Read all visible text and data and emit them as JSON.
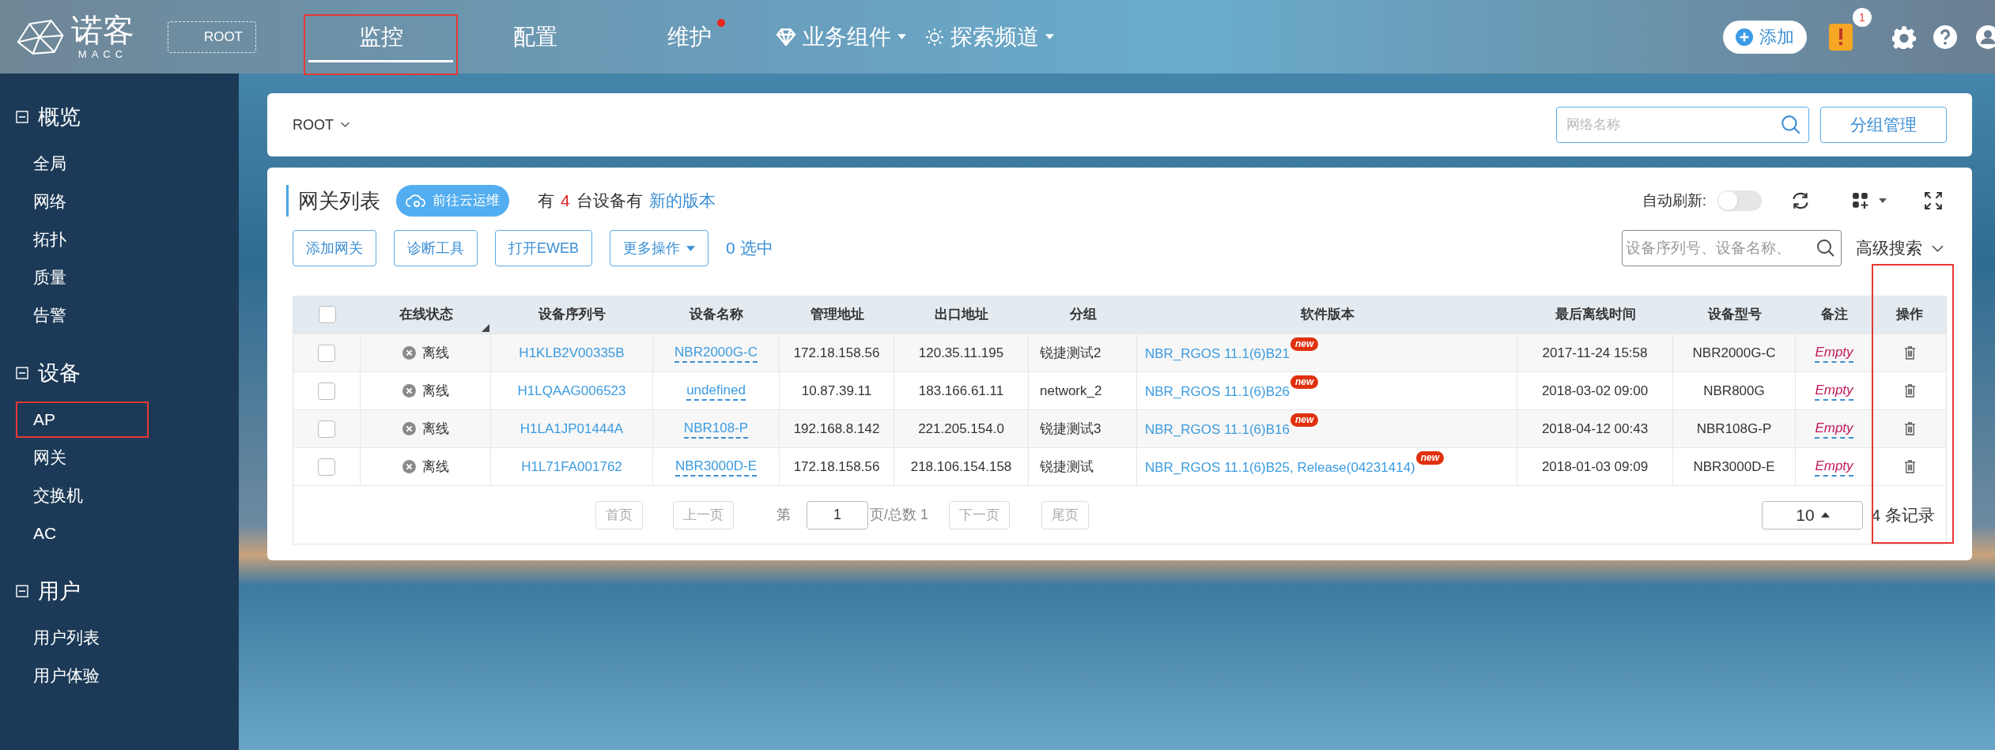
{
  "header": {
    "logo_text": "诺客",
    "logo_subtext": "MACC",
    "root_button": "ROOT",
    "tabs": [
      {
        "label": "监控",
        "selected": true,
        "highlighted": true,
        "dot": false,
        "kind": "plain"
      },
      {
        "label": "配置",
        "selected": false,
        "highlighted": false,
        "dot": false,
        "kind": "plain"
      },
      {
        "label": "维护",
        "selected": false,
        "highlighted": false,
        "dot": true,
        "kind": "plain"
      },
      {
        "label": "业务组件",
        "selected": false,
        "highlighted": false,
        "dot": false,
        "kind": "diamond-menu"
      },
      {
        "label": "探索频道",
        "selected": false,
        "highlighted": false,
        "dot": false,
        "kind": "bulb-menu"
      }
    ],
    "add_button": "添加",
    "alert_count": "1"
  },
  "sidebar": {
    "sections": [
      {
        "title": "概览",
        "expanded": true,
        "items": [
          {
            "label": "全局",
            "highlighted": false
          },
          {
            "label": "网络",
            "highlighted": false
          },
          {
            "label": "拓扑",
            "highlighted": false
          },
          {
            "label": "质量",
            "highlighted": false
          },
          {
            "label": "告警",
            "highlighted": false
          }
        ]
      },
      {
        "title": "设备",
        "expanded": true,
        "items": [
          {
            "label": "AP",
            "highlighted": true
          },
          {
            "label": "网关",
            "highlighted": false
          },
          {
            "label": "交换机",
            "highlighted": false
          },
          {
            "label": "AC",
            "highlighted": false
          }
        ]
      },
      {
        "title": "用户",
        "expanded": true,
        "items": [
          {
            "label": "用户列表",
            "highlighted": false
          },
          {
            "label": "用户体验",
            "highlighted": false
          }
        ]
      }
    ]
  },
  "filter_bar": {
    "scope": "ROOT",
    "search_placeholder": "网络名称",
    "group_button": "分组管理"
  },
  "gateway_panel": {
    "title": "网关列表",
    "cloud_button": "前往云运维",
    "notice_prefix": "有",
    "notice_count": "4",
    "notice_middle": "台设备有",
    "notice_link": "新的版本",
    "auto_refresh_label": "自动刷新:",
    "auto_refresh_on": false,
    "actions": [
      {
        "label": "添加网关",
        "kind": "plain"
      },
      {
        "label": "诊断工具",
        "kind": "plain"
      },
      {
        "label": "打开EWEB",
        "kind": "plain"
      },
      {
        "label": "更多操作",
        "kind": "menu"
      }
    ],
    "selected_count": "0 选中",
    "search_placeholder": "设备序列号、设备名称、",
    "advanced_search": "高级搜索",
    "table": {
      "all_checked": false,
      "columns": [
        {
          "label": "在线状态",
          "highlighted": false,
          "sortable": true
        },
        {
          "label": "设备序列号",
          "highlighted": false,
          "sortable": false
        },
        {
          "label": "设备名称",
          "highlighted": false,
          "sortable": false
        },
        {
          "label": "管理地址",
          "highlighted": false,
          "sortable": false
        },
        {
          "label": "出口地址",
          "highlighted": false,
          "sortable": false
        },
        {
          "label": "分组",
          "highlighted": false,
          "sortable": false
        },
        {
          "label": "软件版本",
          "highlighted": false,
          "sortable": false
        },
        {
          "label": "最后离线时间",
          "highlighted": false,
          "sortable": false
        },
        {
          "label": "设备型号",
          "highlighted": false,
          "sortable": false
        },
        {
          "label": "备注",
          "highlighted": false,
          "sortable": false
        },
        {
          "label": "操作",
          "highlighted": true,
          "sortable": false
        }
      ],
      "rows": [
        {
          "checked": false,
          "status": "离线",
          "serial": "H1KLB2V00335B",
          "name": "NBR2000G-C",
          "mgmt_ip": "172.18.158.56",
          "egress_ip": "120.35.11.195",
          "group": "锐捷测试2",
          "version": "NBR_RGOS 11.1(6)B21",
          "version_badge": "new",
          "last_offline": "2017-11-24 15:58",
          "model": "NBR2000G-C",
          "note": "Empty"
        },
        {
          "checked": false,
          "status": "离线",
          "serial": "H1LQAAG006523",
          "name": "undefined",
          "mgmt_ip": "10.87.39.11",
          "egress_ip": "183.166.61.11",
          "group": "network_2",
          "version": "NBR_RGOS 11.1(6)B26",
          "version_badge": "new",
          "last_offline": "2018-03-02 09:00",
          "model": "NBR800G",
          "note": "Empty"
        },
        {
          "checked": false,
          "status": "离线",
          "serial": "H1LA1JP01444A",
          "name": "NBR108-P",
          "mgmt_ip": "192.168.8.142",
          "egress_ip": "221.205.154.0",
          "group": "锐捷测试3",
          "version": "NBR_RGOS 11.1(6)B16",
          "version_badge": "new",
          "last_offline": "2018-04-12 00:43",
          "model": "NBR108G-P",
          "note": "Empty"
        },
        {
          "checked": false,
          "status": "离线",
          "serial": "H1L71FA001762",
          "name": "NBR3000D-E",
          "mgmt_ip": "172.18.158.56",
          "egress_ip": "218.106.154.158",
          "group": "锐捷测试",
          "version": "NBR_RGOS 11.1(6)B25, Release(04231414)",
          "version_badge": "new",
          "last_offline": "2018-01-03 09:09",
          "model": "NBR3000D-E",
          "note": "Empty"
        }
      ]
    },
    "pagination": {
      "first": "首页",
      "prev": "上一页",
      "page_label": "第",
      "page": "1",
      "total": "页/总数 1",
      "next": "下一页",
      "last": "尾页",
      "page_size": "10",
      "records": "4 条记录"
    }
  }
}
